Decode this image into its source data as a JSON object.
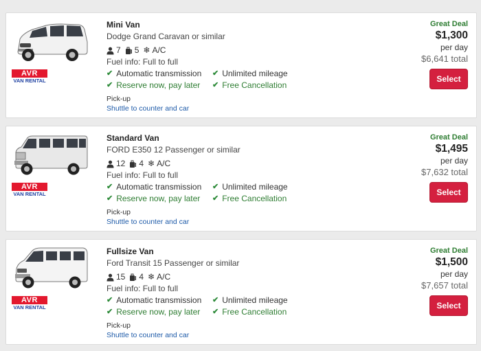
{
  "cars": [
    {
      "category": "Mini Van",
      "model": "Dodge Grand Caravan or similar",
      "passengers": "7",
      "bags": "5",
      "ac": "A/C",
      "fuel": "Fuel info: Full to full",
      "transmission": "Automatic transmission",
      "mileage": "Unlimited mileage",
      "reserve": "Reserve now, pay later",
      "cancellation": "Free Cancellation",
      "pickup_label": "Pick-up",
      "pickup_type": "Shuttle to counter and car",
      "deal": "Great Deal",
      "price": "$1,300",
      "per": "per day",
      "total": "$6,641 total",
      "select": "Select",
      "vendor_top": "AVR",
      "vendor_bottom": "VAN RENTAL",
      "image": "minivan-image"
    },
    {
      "category": "Standard Van",
      "model": "FORD E350 12 Passenger or similar",
      "passengers": "12",
      "bags": "4",
      "ac": "A/C",
      "fuel": "Fuel info: Full to full",
      "transmission": "Automatic transmission",
      "mileage": "Unlimited mileage",
      "reserve": "Reserve now, pay later",
      "cancellation": "Free Cancellation",
      "pickup_label": "Pick-up",
      "pickup_type": "Shuttle to counter and car",
      "deal": "Great Deal",
      "price": "$1,495",
      "per": "per day",
      "total": "$7,632 total",
      "select": "Select",
      "vendor_top": "AVR",
      "vendor_bottom": "VAN RENTAL",
      "image": "passenger-van-image"
    },
    {
      "category": "Fullsize Van",
      "model": "Ford Transit 15 Passenger or similar",
      "passengers": "15",
      "bags": "4",
      "ac": "A/C",
      "fuel": "Fuel info: Full to full",
      "transmission": "Automatic transmission",
      "mileage": "Unlimited mileage",
      "reserve": "Reserve now, pay later",
      "cancellation": "Free Cancellation",
      "pickup_label": "Pick-up",
      "pickup_type": "Shuttle to counter and car",
      "deal": "Great Deal",
      "price": "$1,500",
      "per": "per day",
      "total": "$7,657 total",
      "select": "Select",
      "vendor_top": "AVR",
      "vendor_bottom": "VAN RENTAL",
      "image": "transit-van-image"
    }
  ],
  "colors": {
    "background": "#ebebeb",
    "deal_green": "#2e7d32",
    "check_green": "#2e8b3a",
    "select_button": "#d4203f",
    "link_blue": "#1d5aa8",
    "vendor_red": "#e3182e",
    "vendor_blue": "#1d3fa0"
  }
}
